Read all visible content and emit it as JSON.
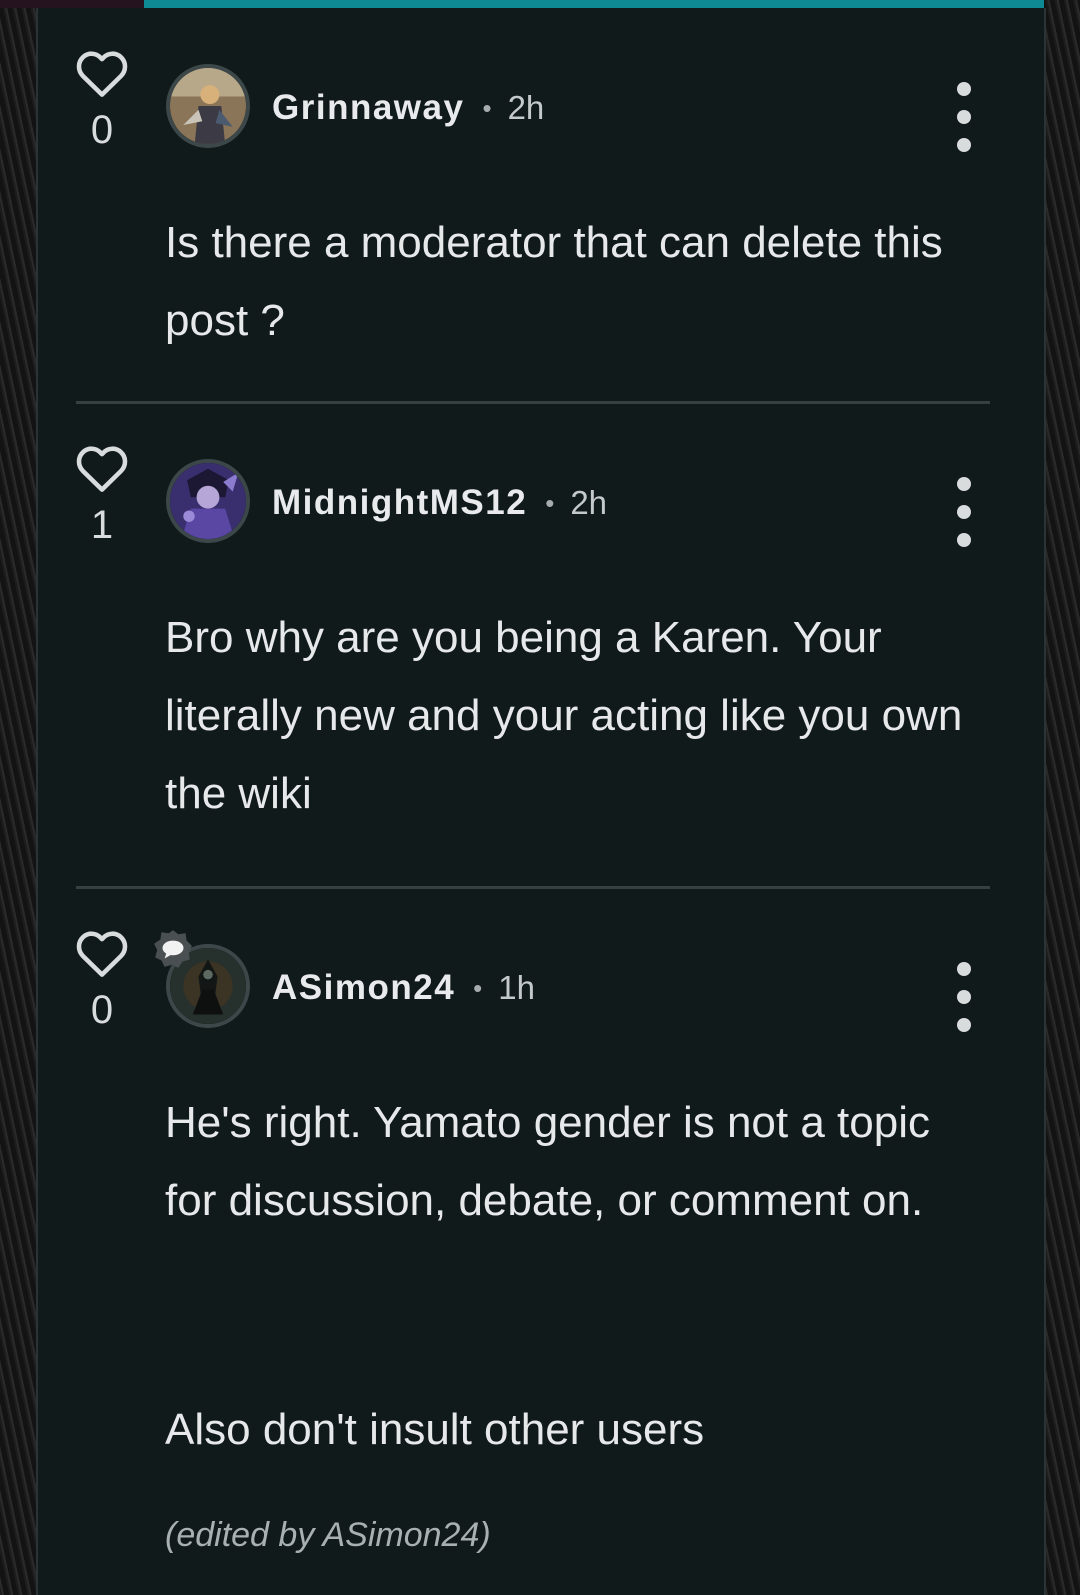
{
  "comments": [
    {
      "likes": "0",
      "username": "Grinnaway",
      "separator": "•",
      "time": "2h",
      "text": "Is there a moderator that can delete this post ?"
    },
    {
      "likes": "1",
      "username": "MidnightMS12",
      "separator": "•",
      "time": "2h",
      "text": "Bro why are you being a Karen. Your literally new and your acting like you own the wiki"
    },
    {
      "likes": "0",
      "username": "ASimon24",
      "separator": "•",
      "time": "1h",
      "text": "He's right. Yamato gender is not a topic for discussion, debate, or comment on.",
      "text2": "Also don't insult other users",
      "edited_note": "(edited by ASimon24)"
    }
  ],
  "colors": {
    "accent": "#0e8a95",
    "panel": "#111a1b",
    "text": "#e6e8e9"
  },
  "icons": {
    "like": "heart-outline-icon",
    "more": "kebab-menu-icon",
    "moderator": "moderator-badge-icon"
  }
}
